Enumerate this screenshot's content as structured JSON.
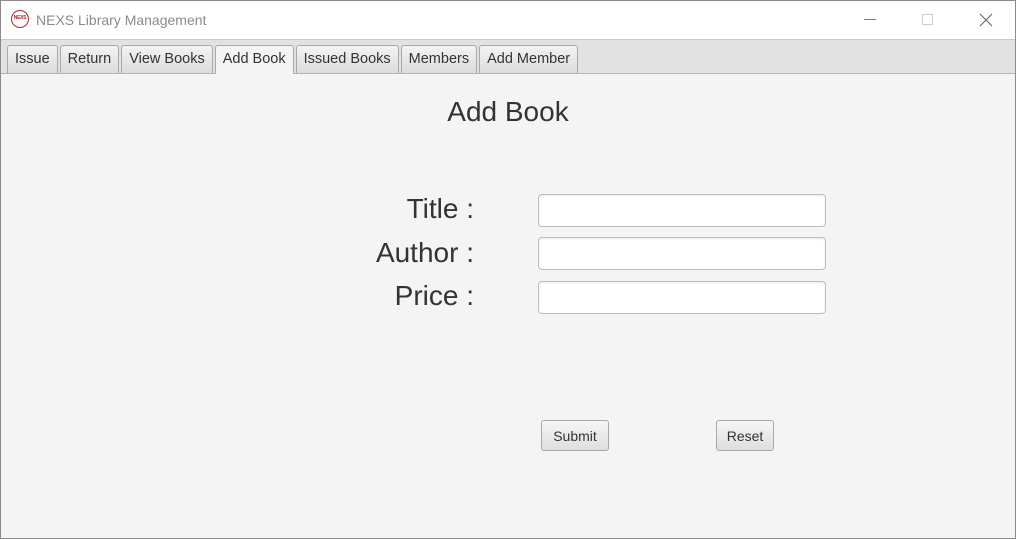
{
  "window": {
    "title": "NEXS Library Management",
    "logo_text": "NEXS"
  },
  "tabs": [
    {
      "label": "Issue",
      "active": false
    },
    {
      "label": "Return",
      "active": false
    },
    {
      "label": "View Books",
      "active": false
    },
    {
      "label": "Add Book",
      "active": true
    },
    {
      "label": "Issued Books",
      "active": false
    },
    {
      "label": "Members",
      "active": false
    },
    {
      "label": "Add Member",
      "active": false
    }
  ],
  "page": {
    "heading": "Add Book"
  },
  "form": {
    "title_label": "Title :",
    "title_value": "",
    "author_label": "Author :",
    "author_value": "",
    "price_label": "Price :",
    "price_value": ""
  },
  "actions": {
    "submit_label": "Submit",
    "reset_label": "Reset"
  },
  "icons": {
    "minimize": "minimize-icon",
    "maximize": "maximize-icon",
    "close": "close-icon"
  },
  "colors": {
    "logo_red": "#b3262a",
    "background": "#f4f4f4",
    "tabbar": "#e2e2e2"
  }
}
